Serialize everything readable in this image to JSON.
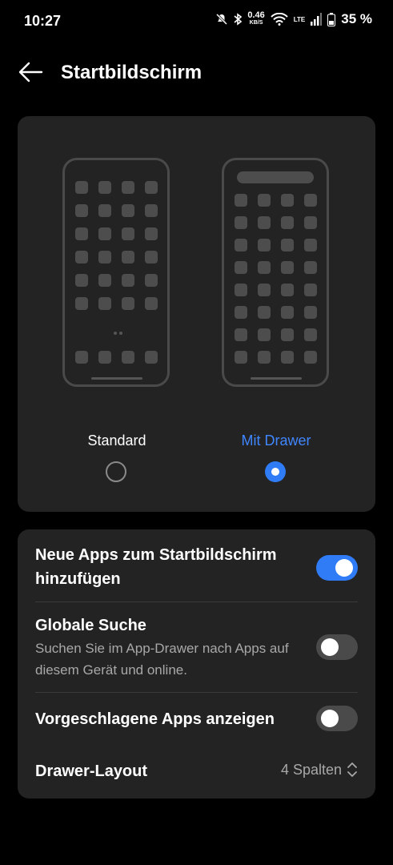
{
  "status_bar": {
    "time": "10:27",
    "speed": "0.46",
    "speed_unit": "KB/S",
    "network": "LTE",
    "battery": "35 %"
  },
  "appbar": {
    "title": "Startbildschirm"
  },
  "layout_picker": {
    "options": [
      {
        "label": "Standard",
        "selected": false
      },
      {
        "label": "Mit Drawer",
        "selected": true
      }
    ],
    "accent_color": "#3f86ff"
  },
  "settings": {
    "new_apps": {
      "label": "Neue Apps zum Startbildschirm hinzufügen",
      "enabled": true
    },
    "global_search": {
      "label": "Globale Suche",
      "description": "Suchen Sie im App-Drawer nach Apps auf diesem Gerät und online.",
      "enabled": false
    },
    "suggested_apps": {
      "label": "Vorgeschlagene Apps anzeigen",
      "enabled": false
    },
    "drawer_layout": {
      "label": "Drawer-Layout",
      "value": "4 Spalten"
    }
  }
}
